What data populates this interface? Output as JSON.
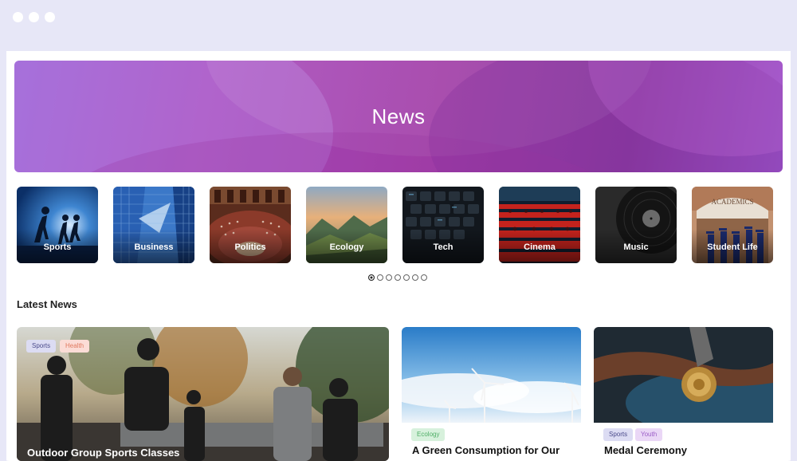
{
  "window": {
    "controls": [
      "window-dot",
      "window-dot",
      "window-dot"
    ]
  },
  "hero": {
    "title": "News"
  },
  "categories": [
    {
      "label": "Sports"
    },
    {
      "label": "Business"
    },
    {
      "label": "Politics"
    },
    {
      "label": "Ecology"
    },
    {
      "label": "Tech"
    },
    {
      "label": "Cinema"
    },
    {
      "label": "Music"
    },
    {
      "label": "Student Life",
      "sign": "ACADEMICS"
    }
  ],
  "pagination": {
    "count": 7,
    "active_index": 0
  },
  "latest": {
    "heading": "Latest News",
    "items": [
      {
        "title": "Outdoor Group Sports Classes",
        "tags": [
          "Sports",
          "Health"
        ]
      },
      {
        "title": "A Green Consumption for Our",
        "tags": [
          "Ecology"
        ]
      },
      {
        "title": "Medal Ceremony",
        "tags": [
          "Sports",
          "Youth"
        ]
      }
    ]
  },
  "colors": {
    "window_bg": "#e7e7f7",
    "hero_accent": "#a23fa8",
    "tag_sports_bg": "#dcdcf3",
    "tag_health_bg": "#fbdcd6",
    "tag_ecology_bg": "#d7f1dc",
    "tag_youth_bg": "#ead7f6"
  }
}
